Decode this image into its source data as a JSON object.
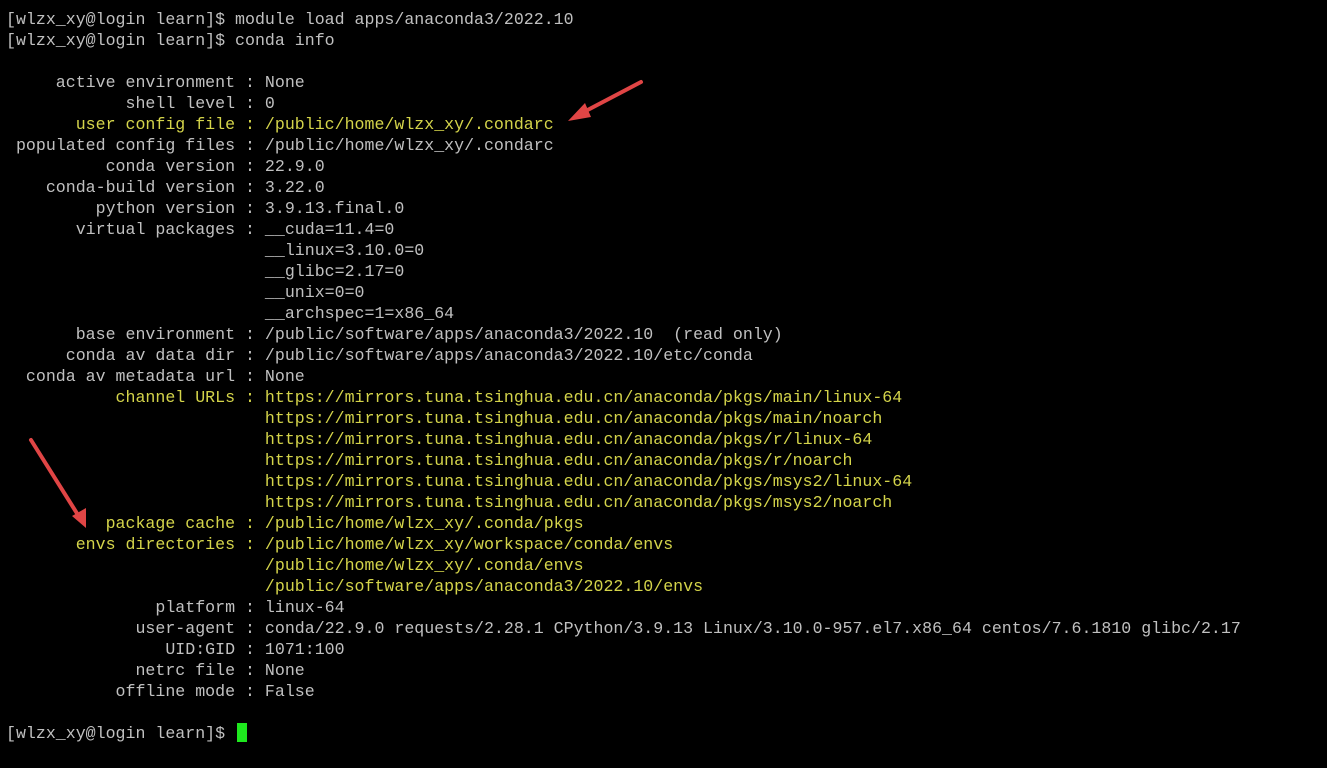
{
  "prompt": "[wlzx_xy@login learn]$ ",
  "commands": [
    "module load apps/anaconda3/2022.10",
    "conda info"
  ],
  "colors": {
    "background": "#000000",
    "text": "#c0c0c0",
    "highlight": "#d4d44a",
    "cursor": "#1ee81e",
    "arrow": "#e04545"
  },
  "info": [
    {
      "key": "     active environment : ",
      "value": "None",
      "hl": false
    },
    {
      "key": "            shell level : ",
      "value": "0",
      "hl": false
    },
    {
      "key": "       user config file : ",
      "value": "/public/home/wlzx_xy/.condarc",
      "hl": true
    },
    {
      "key": " populated config files : ",
      "value": "/public/home/wlzx_xy/.condarc",
      "hl": false
    },
    {
      "key": "          conda version : ",
      "value": "22.9.0",
      "hl": false
    },
    {
      "key": "    conda-build version : ",
      "value": "3.22.0",
      "hl": false
    },
    {
      "key": "         python version : ",
      "value": "3.9.13.final.0",
      "hl": false
    },
    {
      "key": "       virtual packages : ",
      "value": "__cuda=11.4=0",
      "hl": false
    },
    {
      "key": "                          ",
      "value": "__linux=3.10.0=0",
      "hl": false
    },
    {
      "key": "                          ",
      "value": "__glibc=2.17=0",
      "hl": false
    },
    {
      "key": "                          ",
      "value": "__unix=0=0",
      "hl": false
    },
    {
      "key": "                          ",
      "value": "__archspec=1=x86_64",
      "hl": false
    },
    {
      "key": "       base environment : ",
      "value": "/public/software/apps/anaconda3/2022.10  (read only)",
      "hl": false
    },
    {
      "key": "      conda av data dir : ",
      "value": "/public/software/apps/anaconda3/2022.10/etc/conda",
      "hl": false
    },
    {
      "key": "  conda av metadata url : ",
      "value": "None",
      "hl": false
    },
    {
      "key": "           channel URLs : ",
      "value": "https://mirrors.tuna.tsinghua.edu.cn/anaconda/pkgs/main/linux-64",
      "hl": true
    },
    {
      "key": "                          ",
      "value": "https://mirrors.tuna.tsinghua.edu.cn/anaconda/pkgs/main/noarch",
      "hl": true
    },
    {
      "key": "                          ",
      "value": "https://mirrors.tuna.tsinghua.edu.cn/anaconda/pkgs/r/linux-64",
      "hl": true
    },
    {
      "key": "                          ",
      "value": "https://mirrors.tuna.tsinghua.edu.cn/anaconda/pkgs/r/noarch",
      "hl": true
    },
    {
      "key": "                          ",
      "value": "https://mirrors.tuna.tsinghua.edu.cn/anaconda/pkgs/msys2/linux-64",
      "hl": true
    },
    {
      "key": "                          ",
      "value": "https://mirrors.tuna.tsinghua.edu.cn/anaconda/pkgs/msys2/noarch",
      "hl": true
    },
    {
      "key": "          package cache : ",
      "value": "/public/home/wlzx_xy/.conda/pkgs",
      "hl": true
    },
    {
      "key": "       envs directories : ",
      "value": "/public/home/wlzx_xy/workspace/conda/envs",
      "hl": true
    },
    {
      "key": "                          ",
      "value": "/public/home/wlzx_xy/.conda/envs",
      "hl": true
    },
    {
      "key": "                          ",
      "value": "/public/software/apps/anaconda3/2022.10/envs",
      "hl": true
    },
    {
      "key": "               platform : ",
      "value": "linux-64",
      "hl": false
    },
    {
      "key": "             user-agent : ",
      "value": "conda/22.9.0 requests/2.28.1 CPython/3.9.13 Linux/3.10.0-957.el7.x86_64 centos/7.6.1810 glibc/2.17",
      "hl": false
    },
    {
      "key": "                UID:GID : ",
      "value": "1071:100",
      "hl": false
    },
    {
      "key": "             netrc file : ",
      "value": "None",
      "hl": false
    },
    {
      "key": "           offline mode : ",
      "value": "False",
      "hl": false
    }
  ]
}
